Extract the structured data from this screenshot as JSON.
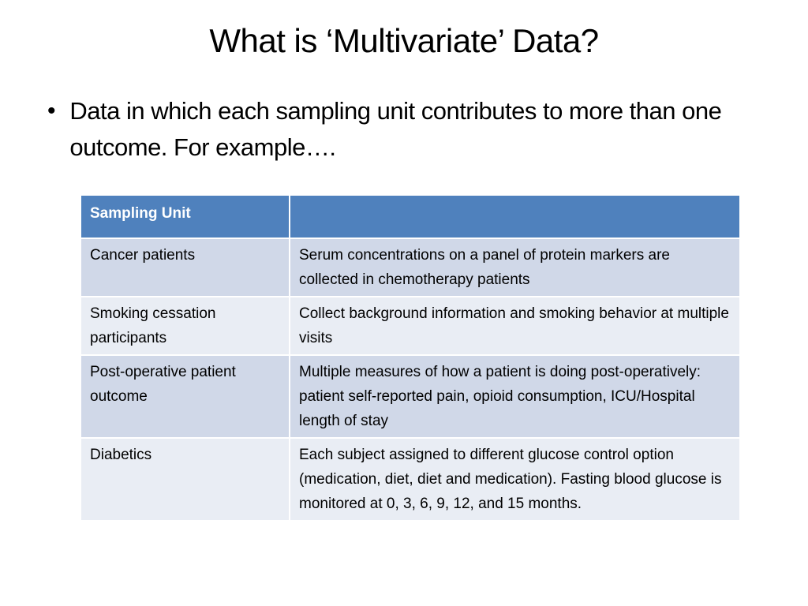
{
  "slide": {
    "title": "What is ‘Multivariate’ Data?",
    "bullet": {
      "marker": "•",
      "text": "Data in which each sampling unit contributes to more than one outcome.  For example…."
    },
    "table": {
      "headers": [
        "Sampling Unit",
        ""
      ],
      "rows": [
        {
          "unit": "Cancer patients",
          "description": "Serum concentrations on a panel of protein markers are collected in chemotherapy patients"
        },
        {
          "unit": "Smoking cessation participants",
          "description": "Collect background information and smoking behavior at multiple  visits"
        },
        {
          "unit": "Post-operative patient outcome",
          "description": "Multiple measures of how a patient is doing post-operatively: patient self-reported pain, opioid consumption, ICU/Hospital length of stay"
        },
        {
          "unit": "Diabetics",
          "description": "Each subject assigned to different glucose control option (medication, diet, diet and medication). Fasting blood glucose is monitored at 0, 3, 6, 9, 12, and 15 months."
        }
      ]
    },
    "colors": {
      "header_bg": "#4f81bd",
      "row_odd_bg": "#d0d8e8",
      "row_even_bg": "#e9edf4"
    }
  }
}
